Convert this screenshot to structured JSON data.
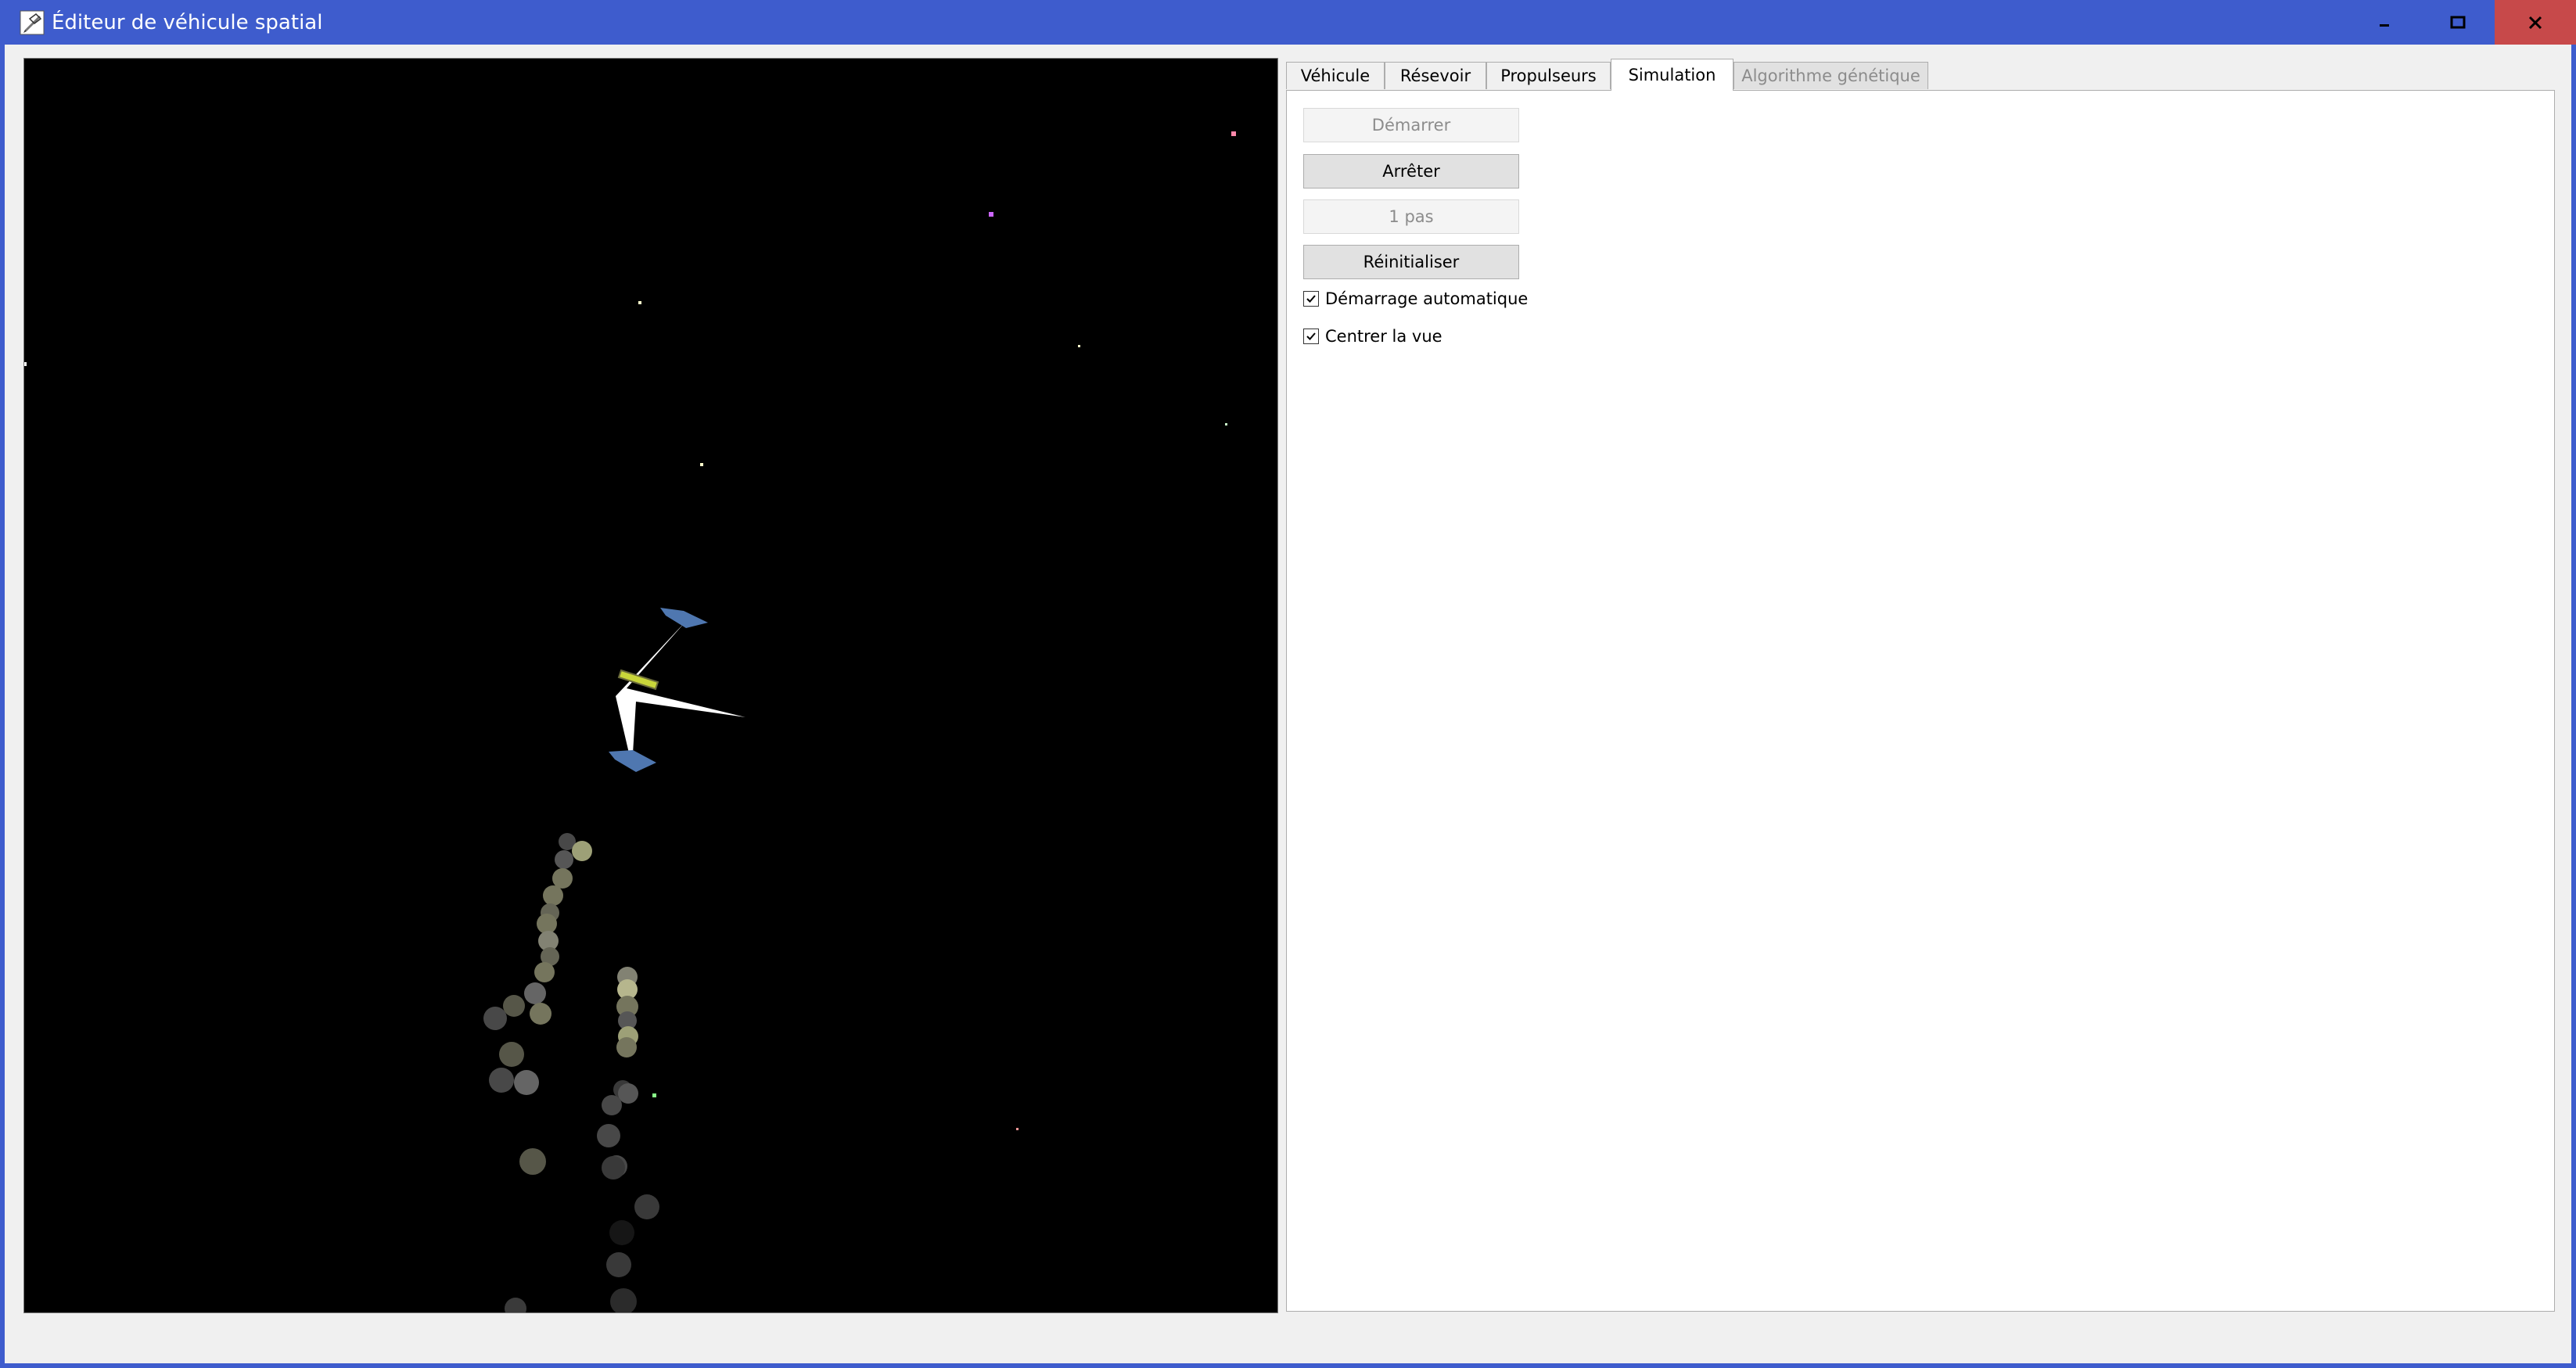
{
  "window": {
    "title": "Éditeur de véhicule spatial",
    "title_icon": "pencil-rocket-icon",
    "controls": {
      "minimize_icon": "minimize-icon",
      "maximize_icon": "maximize-icon",
      "close_icon": "close-icon",
      "close_color": "#c7494a"
    },
    "titlebar_color": "#3e5ccd"
  },
  "tabs": [
    {
      "label": "Véhicule",
      "state": "normal"
    },
    {
      "label": "Résevoir",
      "state": "normal"
    },
    {
      "label": "Propulseurs",
      "state": "normal"
    },
    {
      "label": "Simulation",
      "state": "active"
    },
    {
      "label": "Algorithme génétique",
      "state": "disabled"
    }
  ],
  "simulation": {
    "buttons": [
      {
        "label": "Démarrer",
        "enabled": false
      },
      {
        "label": "Arrêter",
        "enabled": true
      },
      {
        "label": "1 pas",
        "enabled": false
      },
      {
        "label": "Réinitialiser",
        "enabled": true
      }
    ],
    "checkboxes": [
      {
        "label": "Démarrage automatique",
        "checked": true
      },
      {
        "label": "Centrer la vue",
        "checked": true
      }
    ]
  },
  "viewport": {
    "background": "#000000",
    "ship_colors": {
      "hull": "#ffffff",
      "thruster": "#4f77b0",
      "tank": "#c9d63a"
    },
    "particle_colors": [
      "#8a8a6e",
      "#b9bc8c",
      "#666666",
      "#d6d6a6"
    ]
  }
}
